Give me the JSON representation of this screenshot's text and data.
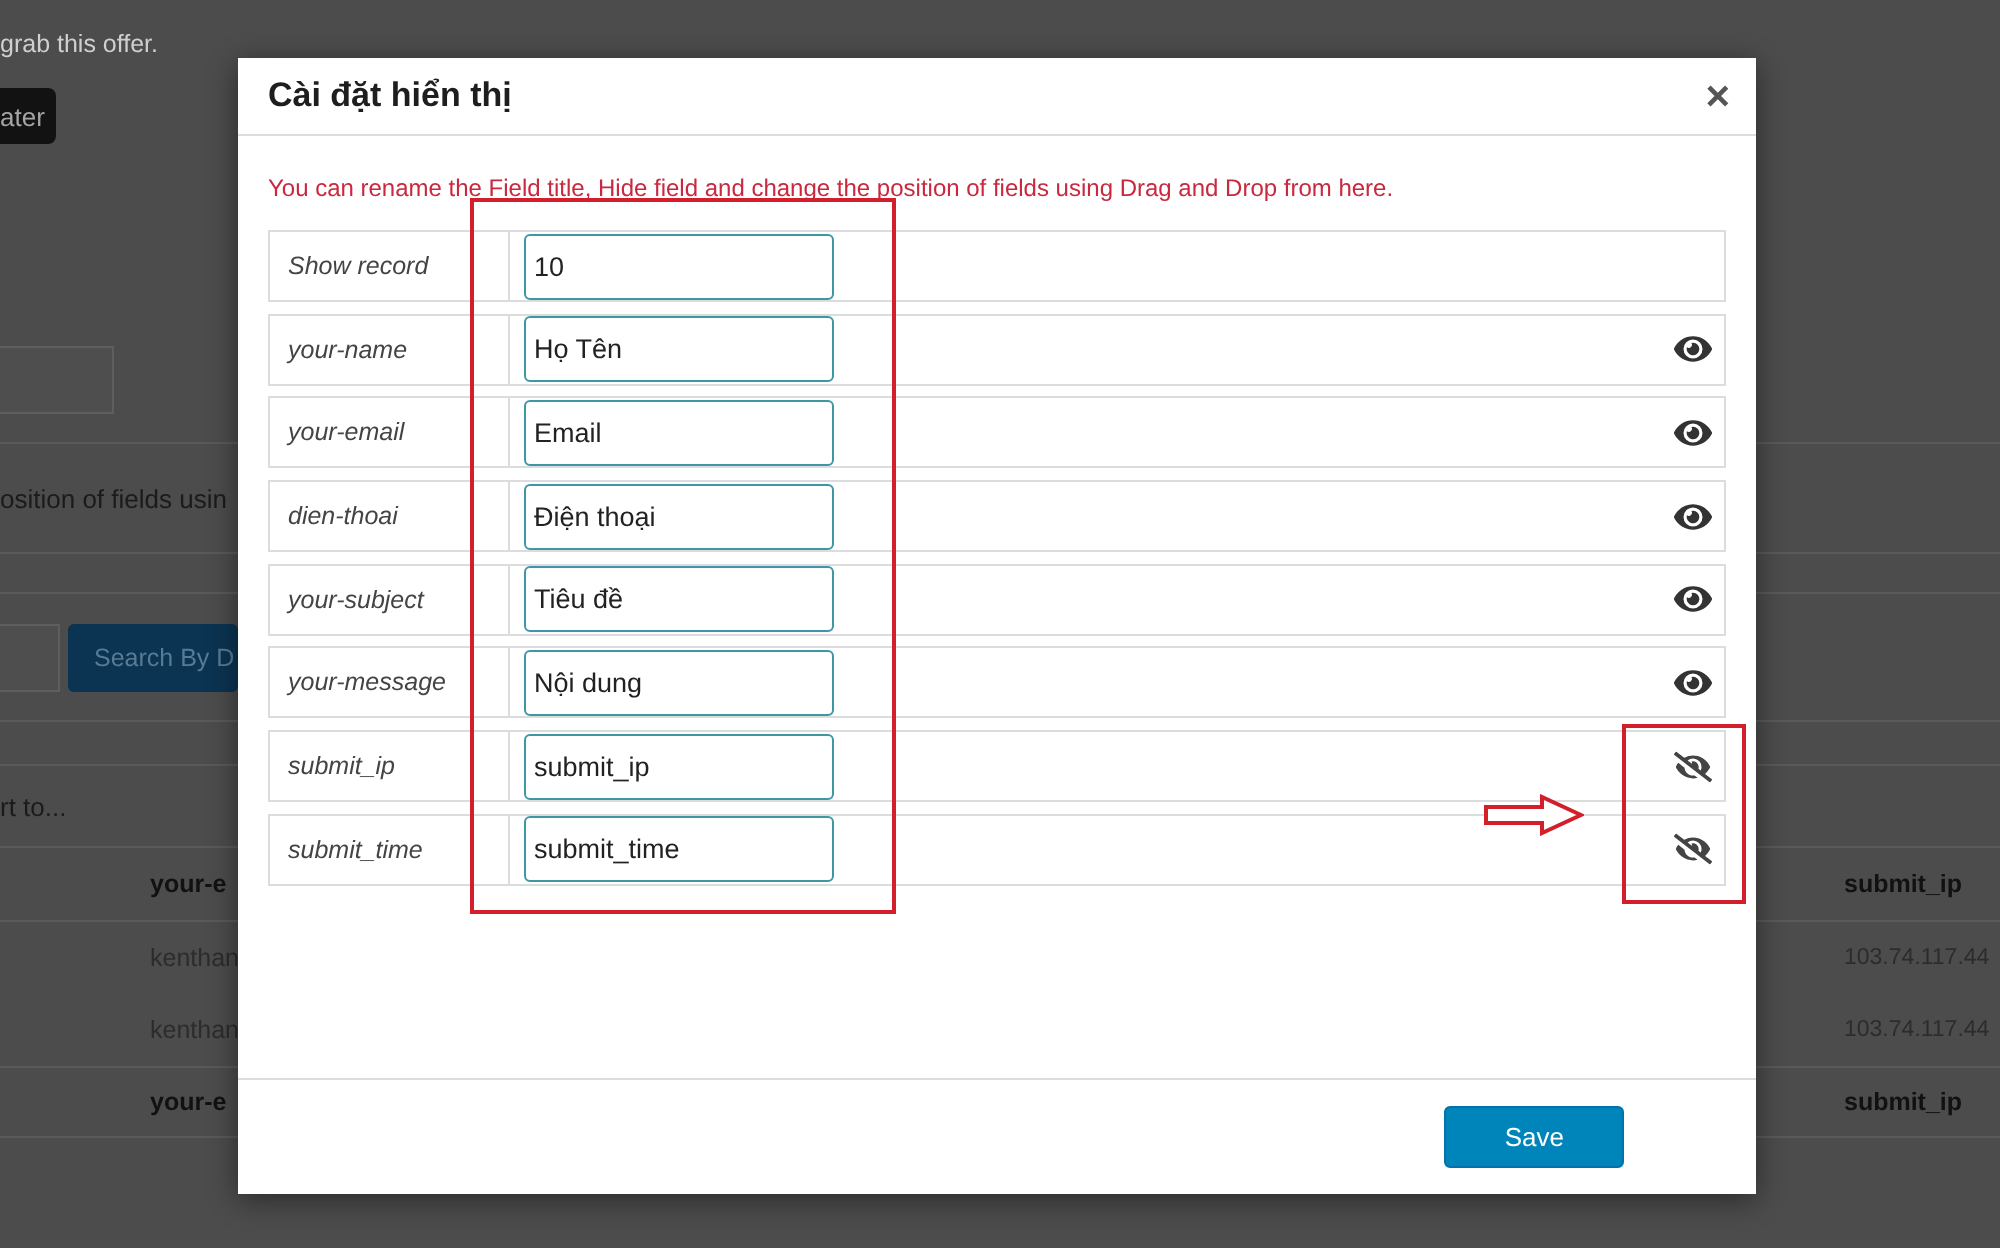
{
  "background_page": {
    "notice_text": "grab this offer.",
    "later_button": "ater",
    "filter_text": "osition of fields usin",
    "search_button": "Search By D",
    "export_text": "rt to...",
    "table": {
      "columns": [
        "your-e",
        "submit_ip"
      ],
      "rows": [
        [
          "kenthan",
          "103.74.117.44"
        ],
        [
          "kenthan",
          "103.74.117.44"
        ]
      ],
      "footer": [
        "your-e",
        "submit_ip"
      ]
    }
  },
  "dialog": {
    "title": "Cài đặt hiển thị",
    "close": "×",
    "message": "You can rename the Field title, Hide field and change the position of fields using Drag and Drop from here.",
    "fields": [
      {
        "kind": "setting",
        "name": "Show record",
        "value": "10"
      },
      {
        "kind": "field",
        "name": "your-name",
        "value": "Họ Tên",
        "visible": true
      },
      {
        "kind": "field",
        "name": "your-email",
        "value": "Email",
        "visible": true
      },
      {
        "kind": "field",
        "name": "dien-thoai",
        "value": "Điện thoại",
        "visible": true
      },
      {
        "kind": "field",
        "name": "your-subject",
        "value": "Tiêu đề",
        "visible": true
      },
      {
        "kind": "field",
        "name": "your-message",
        "value": "Nội dung",
        "visible": true
      },
      {
        "kind": "field",
        "name": "submit_ip",
        "value": "submit_ip",
        "visible": false
      },
      {
        "kind": "field",
        "name": "submit_time",
        "value": "submit_time",
        "visible": false
      }
    ],
    "save_button": "Save"
  }
}
